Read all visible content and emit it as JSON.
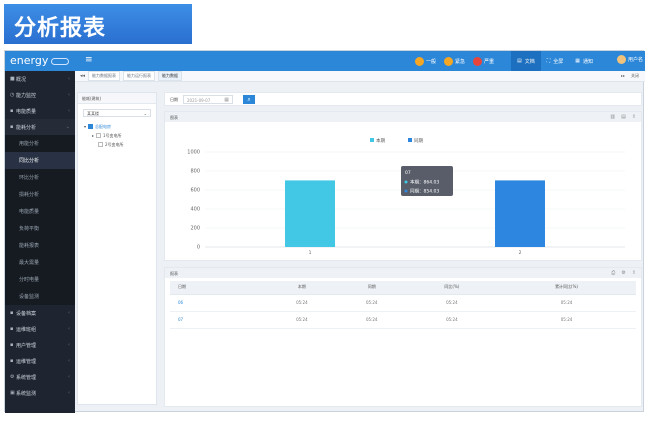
{
  "banner": {
    "title": "分析报表"
  },
  "topbar": {
    "logo": "energy",
    "alerts": [
      {
        "label": "一般",
        "color": "#f5a623"
      },
      {
        "label": "紧急",
        "color": "#f5a623"
      },
      {
        "label": "严重",
        "color": "#e8443a"
      }
    ],
    "nav": [
      {
        "label": "文档",
        "icon": "doc-icon",
        "active": true
      },
      {
        "label": "全屏",
        "icon": "fullscreen-icon",
        "active": false
      },
      {
        "label": "通知",
        "icon": "bell-icon",
        "active": false
      }
    ],
    "user": "用户名"
  },
  "sidebar": {
    "items": [
      {
        "label": "概况",
        "icon": "home-icon"
      },
      {
        "label": "能力监控",
        "icon": "monitor-icon"
      },
      {
        "label": "电能质量",
        "icon": "quality-icon"
      },
      {
        "label": "能耗分析",
        "icon": "analysis-icon",
        "expanded": true
      }
    ],
    "subitems": [
      {
        "label": "用能分析",
        "active": false
      },
      {
        "label": "同比分析",
        "active": true
      },
      {
        "label": "环比分析",
        "active": false
      },
      {
        "label": "损耗分析",
        "active": false
      },
      {
        "label": "电能质量",
        "active": false
      },
      {
        "label": "负荷平衡",
        "active": false
      },
      {
        "label": "能耗报表",
        "active": false
      },
      {
        "label": "最大需量",
        "active": false
      },
      {
        "label": "分时电量",
        "active": false
      },
      {
        "label": "设备监测",
        "active": false
      }
    ],
    "bottom": [
      {
        "label": "设备档案",
        "icon": "file-icon"
      },
      {
        "label": "运维班组",
        "icon": "team-icon"
      },
      {
        "label": "用户管理",
        "icon": "user-icon"
      },
      {
        "label": "运维管理",
        "icon": "wrench-icon"
      },
      {
        "label": "系统管理",
        "icon": "gear-icon"
      },
      {
        "label": "系统监测",
        "icon": "screen-icon"
      }
    ]
  },
  "tabs": {
    "items": [
      {
        "label": "能力数据报表",
        "active": false
      },
      {
        "label": "能力运行报表",
        "active": false
      },
      {
        "label": "能力数据",
        "active": true
      }
    ],
    "tools": [
      "关闭"
    ]
  },
  "tree": {
    "header": "能耗(建筑)",
    "select_value": "某某楼",
    "nodes": [
      {
        "label": "总配电房",
        "level": 0,
        "root": true
      },
      {
        "label": "1号变电所",
        "level": 1,
        "root": false
      },
      {
        "label": "2号变电所",
        "level": 1,
        "root": false
      }
    ]
  },
  "filter": {
    "label": "日期",
    "date_value": "2021-09-07"
  },
  "chart_panel": {
    "title": "图表"
  },
  "table_panel": {
    "title": "报表",
    "headers": [
      "日期",
      "本期",
      "同期",
      "同比(%)",
      "累计同比(%)"
    ],
    "rows": [
      [
        "06",
        "05:24",
        "05:24",
        "05:24",
        "05:24"
      ],
      [
        "07",
        "05:24",
        "05:24",
        "05:24",
        "05:24"
      ]
    ]
  },
  "chart_data": {
    "type": "bar",
    "categories": [
      "1",
      "2"
    ],
    "series": [
      {
        "name": "本期",
        "color": "#42c7e4",
        "values": [
          701,
          0
        ]
      },
      {
        "name": "同期",
        "color": "#2d86e0",
        "values": [
          0,
          701
        ]
      }
    ],
    "ylim": [
      0,
      1000
    ],
    "yticks": [
      0,
      200,
      400,
      600,
      800,
      1000
    ],
    "legend": "top-center",
    "tooltip": {
      "title": "07",
      "lines": [
        "本期：864.03",
        "同期：854.03"
      ]
    }
  }
}
